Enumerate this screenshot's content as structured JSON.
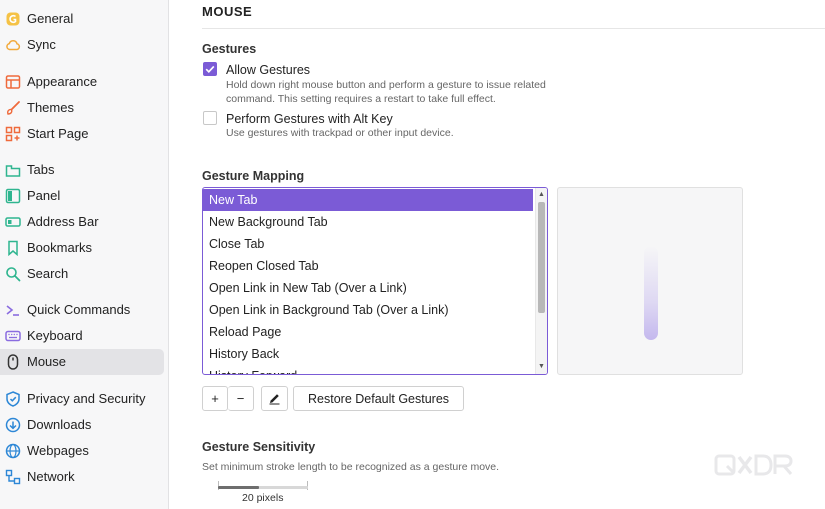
{
  "sidebar": {
    "items": [
      {
        "label": "General",
        "icon": "general-icon"
      },
      {
        "label": "Sync",
        "icon": "cloud-icon"
      },
      {
        "label": "Appearance",
        "icon": "appearance-icon"
      },
      {
        "label": "Themes",
        "icon": "brush-icon"
      },
      {
        "label": "Start Page",
        "icon": "start-page-icon"
      },
      {
        "label": "Tabs",
        "icon": "tabs-icon"
      },
      {
        "label": "Panel",
        "icon": "panel-icon"
      },
      {
        "label": "Address Bar",
        "icon": "address-bar-icon"
      },
      {
        "label": "Bookmarks",
        "icon": "bookmark-icon"
      },
      {
        "label": "Search",
        "icon": "search-icon"
      },
      {
        "label": "Quick Commands",
        "icon": "quick-commands-icon"
      },
      {
        "label": "Keyboard",
        "icon": "keyboard-icon"
      },
      {
        "label": "Mouse",
        "icon": "mouse-icon",
        "active": true
      },
      {
        "label": "Privacy and Security",
        "icon": "shield-icon"
      },
      {
        "label": "Downloads",
        "icon": "download-icon"
      },
      {
        "label": "Webpages",
        "icon": "globe-icon"
      },
      {
        "label": "Network",
        "icon": "network-icon"
      }
    ]
  },
  "main": {
    "section_title": "MOUSE",
    "gestures": {
      "title": "Gestures",
      "allow_label": "Allow Gestures",
      "allow_checked": true,
      "allow_desc": "Hold down right mouse button and perform a gesture to issue related command. This setting requires a restart to take full effect.",
      "alt_label": "Perform Gestures with Alt Key",
      "alt_checked": false,
      "alt_desc": "Use gestures with trackpad or other input device."
    },
    "mapping": {
      "title": "Gesture Mapping",
      "items": [
        "New Tab",
        "New Background Tab",
        "Close Tab",
        "Reopen Closed Tab",
        "Open Link in New Tab (Over a Link)",
        "Open Link in Background Tab (Over a Link)",
        "Reload Page",
        "History Back",
        "History Forward"
      ],
      "selected_index": 0,
      "add_label": "+",
      "remove_label": "−",
      "restore_label": "Restore Default Gestures"
    },
    "sensitivity": {
      "title": "Gesture Sensitivity",
      "desc": "Set minimum stroke length to be recognized as a gesture move.",
      "value_label": "20 pixels",
      "slider_fraction": 0.45
    }
  },
  "colors": {
    "accent": "#7b5bd6",
    "sidebar_bg": "#f7f7f8",
    "active_item_bg": "#e3e3e6"
  }
}
